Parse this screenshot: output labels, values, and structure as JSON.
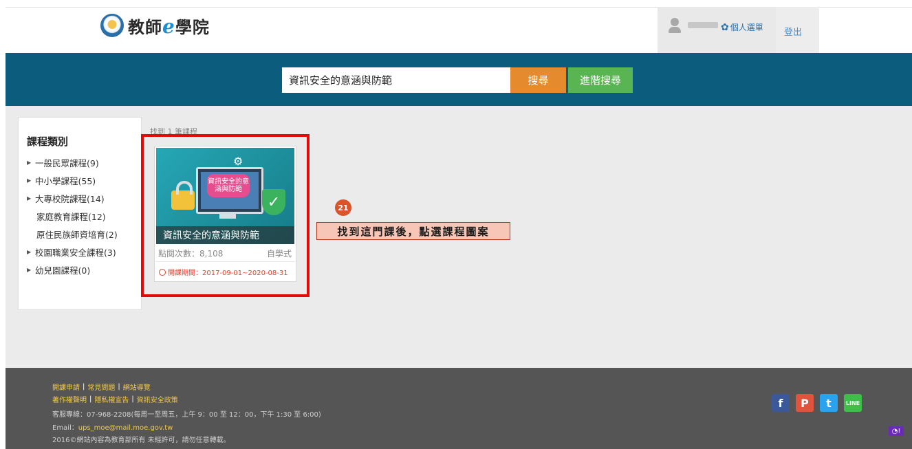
{
  "header": {
    "logo_text_a": "教師",
    "logo_text_e": "e",
    "logo_text_b": "學院",
    "menu_label": "個人選單",
    "logout_label": "登出"
  },
  "search": {
    "value": "資訊安全的意涵與防範",
    "search_button": "搜尋",
    "advanced_button": "進階搜尋"
  },
  "sidebar": {
    "title": "課程類別",
    "items": [
      {
        "label": "一般民眾課程(9)"
      },
      {
        "label": "中小學課程(55)"
      },
      {
        "label": "大專校院課程(14)"
      },
      {
        "label": "家庭教育課程(12)"
      },
      {
        "label": "原住民族師資培育(2)"
      },
      {
        "label": "校園職業安全課程(3)"
      },
      {
        "label": "幼兒園課程(0)"
      }
    ]
  },
  "results": {
    "found_text": "找到 1 筆課程"
  },
  "course": {
    "thumb_text": "資訊安全的意涵與防範",
    "title": "資訊安全的意涵與防範",
    "views": "點閱次數：8,108",
    "mode": "自學式",
    "period": "開課期間：2017-09-01~2020-08-31"
  },
  "annotation": {
    "step": "21",
    "note": "找到這門課後，點選課程圖案",
    "border_color": "#e20b0b"
  },
  "footer": {
    "links_row1": [
      "開課申請",
      "常見問題",
      "網站導覽"
    ],
    "links_row2": [
      "著作權聲明",
      "隱私權宣告",
      "資訊安全政策"
    ],
    "service": "客服專線：07-968-2208(每周一至周五，上午 9：00 至 12：00，下午 1:30 至 6:00)",
    "email_label": "Email：",
    "email": "ups_moe@mail.moe.gov.tw",
    "copyright": "2016©網站內容為教育部所有 未經許可，請勿任意轉載。"
  },
  "social": [
    {
      "name": "facebook",
      "glyph": "f",
      "color": "#3b5998"
    },
    {
      "name": "plurk",
      "glyph": "P",
      "color": "#e0533d"
    },
    {
      "name": "twitter",
      "glyph": "t",
      "color": "#2aa3ef"
    },
    {
      "name": "line",
      "glyph": "LINE",
      "color": "#3dbf4a"
    }
  ],
  "colors": {
    "banner": "#0b5c7d",
    "search_button": "#e68a2e",
    "advanced_button": "#58b551"
  }
}
